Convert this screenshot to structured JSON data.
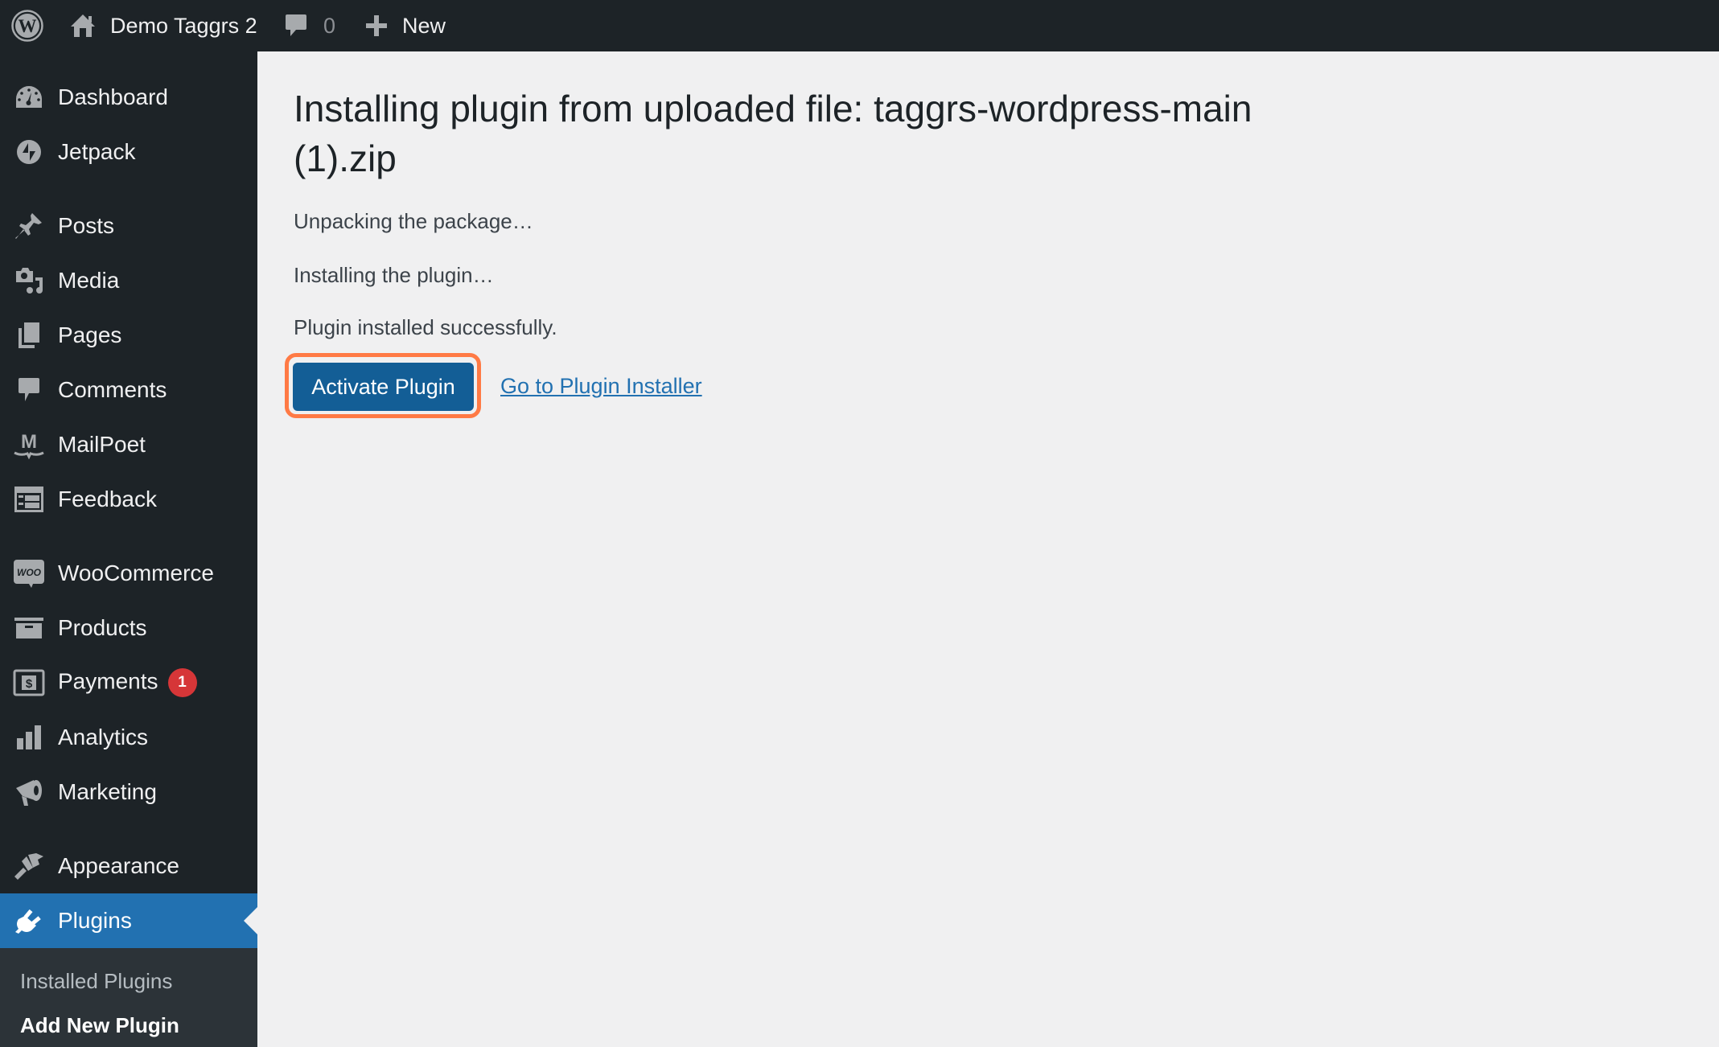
{
  "adminbar": {
    "logo_icon": "wordpress-logo-icon",
    "site_icon": "home-icon",
    "site_name": "Demo Taggrs 2",
    "comments_icon": "comment-bubble-icon",
    "comments_count": "0",
    "new_icon": "plus-icon",
    "new_label": "New"
  },
  "sidebar": {
    "items": [
      {
        "label": "Dashboard",
        "icon": "dashboard-gauge-icon"
      },
      {
        "label": "Jetpack",
        "icon": "jetpack-bolt-icon"
      },
      {
        "label": "Posts",
        "icon": "pushpin-icon"
      },
      {
        "label": "Media",
        "icon": "media-camera-music-icon"
      },
      {
        "label": "Pages",
        "icon": "pages-icon"
      },
      {
        "label": "Comments",
        "icon": "comment-bubble-icon"
      },
      {
        "label": "MailPoet",
        "icon": "mailpoet-icon"
      },
      {
        "label": "Feedback",
        "icon": "feedback-form-icon"
      },
      {
        "label": "WooCommerce",
        "icon": "woo-icon"
      },
      {
        "label": "Products",
        "icon": "archive-box-icon"
      },
      {
        "label": "Payments",
        "icon": "dollar-bill-icon",
        "badge": "1"
      },
      {
        "label": "Analytics",
        "icon": "bar-chart-icon"
      },
      {
        "label": "Marketing",
        "icon": "megaphone-icon"
      },
      {
        "label": "Appearance",
        "icon": "paintbrush-icon"
      },
      {
        "label": "Plugins",
        "icon": "plug-icon",
        "current": true
      }
    ],
    "submenu": [
      {
        "label": "Installed Plugins"
      },
      {
        "label": "Add New Plugin",
        "current": true
      }
    ]
  },
  "main": {
    "title": "Installing plugin from uploaded file: taggrs-wordpress-main (1).zip",
    "messages": [
      "Unpacking the package…",
      "Installing the plugin…",
      "Plugin installed successfully."
    ],
    "activate_button": "Activate Plugin",
    "installer_link": "Go to Plugin Installer"
  },
  "colors": {
    "adminbar_bg": "#1d2327",
    "menu_current": "#2271b1",
    "button_primary": "#135e96",
    "highlight": "#ff7a45",
    "badge": "#d63638",
    "link": "#2271b1"
  }
}
